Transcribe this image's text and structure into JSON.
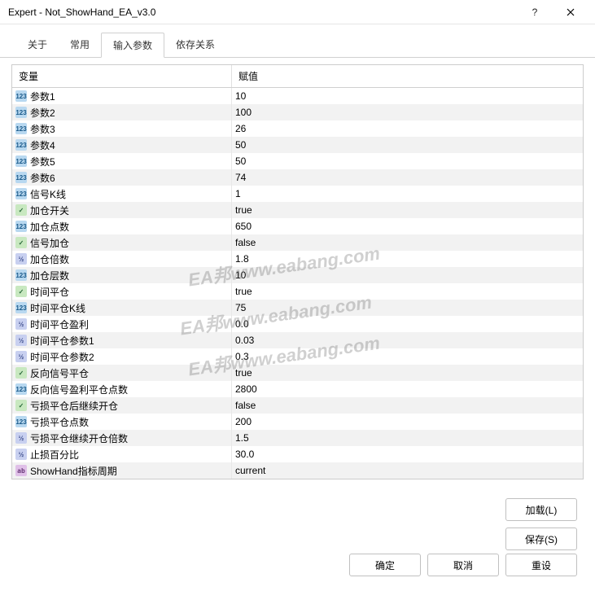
{
  "window": {
    "title": "Expert - Not_ShowHand_EA_v3.0",
    "help": "?",
    "close": "×"
  },
  "tabs": [
    "关于",
    "常用",
    "输入参数",
    "依存关系"
  ],
  "activeTab": 2,
  "columns": {
    "variable": "变量",
    "value": "赋值"
  },
  "rows": [
    {
      "icon": "int",
      "name": "参数1",
      "value": "10"
    },
    {
      "icon": "int",
      "name": "参数2",
      "value": "100"
    },
    {
      "icon": "int",
      "name": "参数3",
      "value": "26"
    },
    {
      "icon": "int",
      "name": "参数4",
      "value": "50"
    },
    {
      "icon": "int",
      "name": "参数5",
      "value": "50"
    },
    {
      "icon": "int",
      "name": "参数6",
      "value": "74"
    },
    {
      "icon": "int",
      "name": "信号K线",
      "value": "1"
    },
    {
      "icon": "bool",
      "name": "加仓开关",
      "value": "true"
    },
    {
      "icon": "int",
      "name": "加仓点数",
      "value": "650"
    },
    {
      "icon": "bool",
      "name": "信号加仓",
      "value": "false"
    },
    {
      "icon": "dbl",
      "name": "加仓倍数",
      "value": "1.8"
    },
    {
      "icon": "int",
      "name": "加仓层数",
      "value": "10"
    },
    {
      "icon": "bool",
      "name": "时间平仓",
      "value": "true"
    },
    {
      "icon": "int",
      "name": "时间平仓K线",
      "value": "75"
    },
    {
      "icon": "dbl",
      "name": "时间平仓盈利",
      "value": "0.0"
    },
    {
      "icon": "dbl",
      "name": "时间平仓参数1",
      "value": "0.03"
    },
    {
      "icon": "dbl",
      "name": "时间平仓参数2",
      "value": "0.3"
    },
    {
      "icon": "bool",
      "name": "反向信号平仓",
      "value": "true"
    },
    {
      "icon": "int",
      "name": "反向信号盈利平仓点数",
      "value": "2800"
    },
    {
      "icon": "bool",
      "name": "亏损平仓后继续开仓",
      "value": "false"
    },
    {
      "icon": "int",
      "name": "亏损平仓点数",
      "value": "200"
    },
    {
      "icon": "dbl",
      "name": "亏损平仓继续开仓倍数",
      "value": "1.5"
    },
    {
      "icon": "dbl",
      "name": "止损百分比",
      "value": "30.0"
    },
    {
      "icon": "str",
      "name": "ShowHand指标周期",
      "value": "current"
    }
  ],
  "buttons": {
    "load": "加载(L)",
    "save": "保存(S)",
    "ok": "确定",
    "cancel": "取消",
    "reset": "重设"
  },
  "watermark": "EA邦www.eabang.com",
  "iconGlyph": {
    "int": "123",
    "bool": "✓",
    "dbl": "½",
    "str": "ab"
  }
}
